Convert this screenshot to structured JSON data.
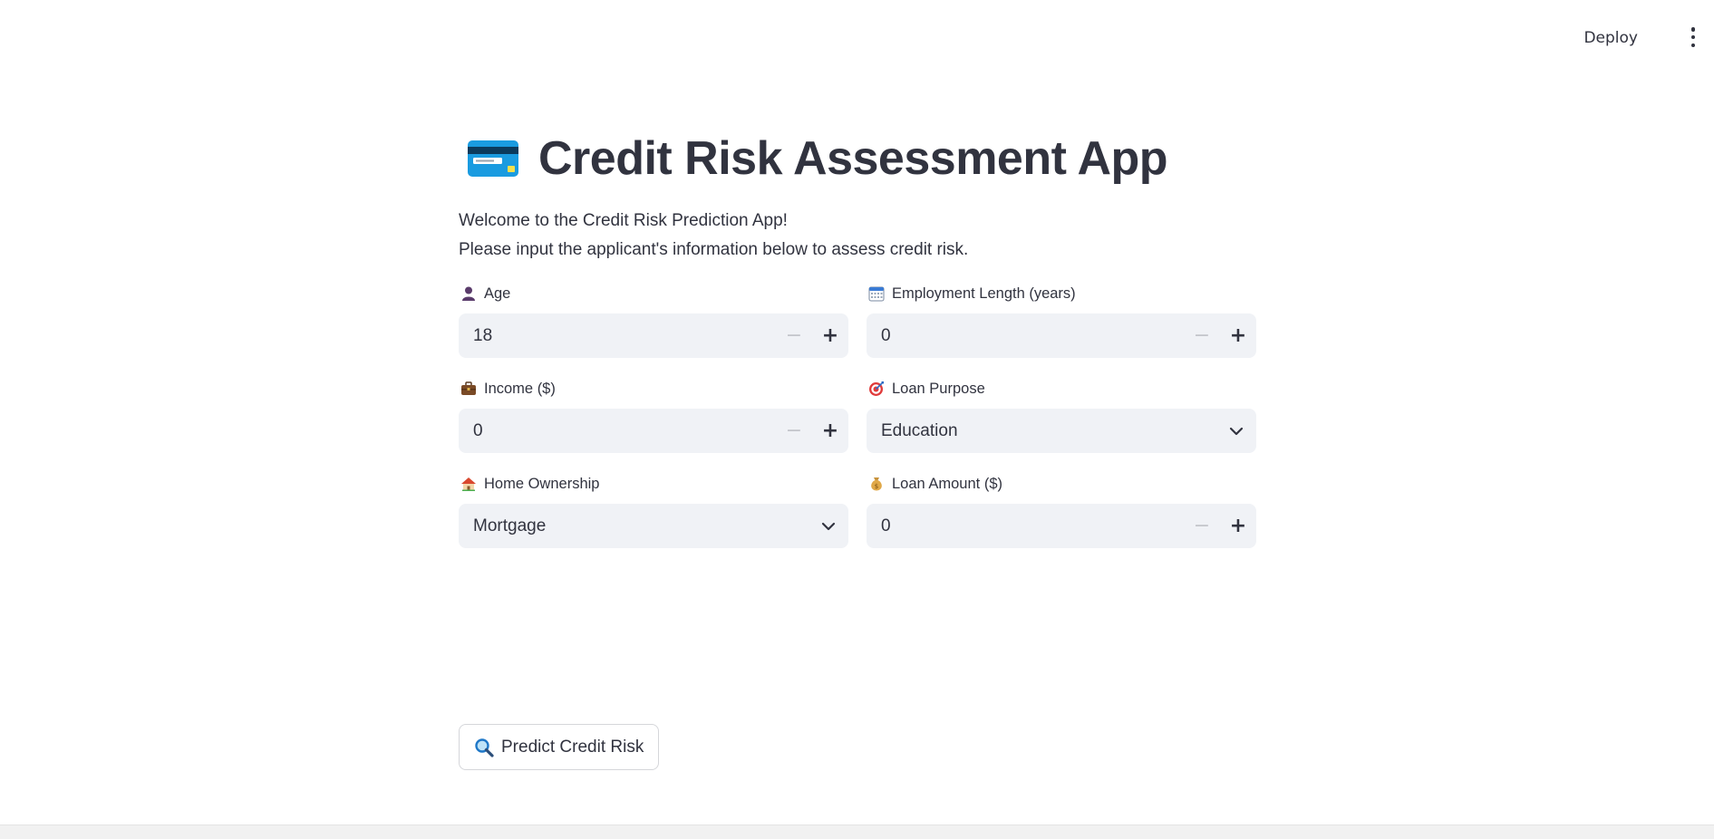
{
  "header": {
    "deploy_label": "Deploy",
    "menu_icon": "kebab-menu-icon"
  },
  "main": {
    "title": "Credit Risk Assessment App",
    "title_icon": "credit-card-icon",
    "intro_line1": "Welcome to the Credit Risk Prediction App!",
    "intro_line2": "Please input the applicant's information below to assess credit risk."
  },
  "fields": {
    "age": {
      "label": "Age",
      "icon": "person-icon",
      "value": "18"
    },
    "employment": {
      "label": "Employment Length (years)",
      "icon": "calendar-icon",
      "value": "0"
    },
    "income": {
      "label": "Income ($)",
      "icon": "briefcase-icon",
      "value": "0"
    },
    "loan_purpose": {
      "label": "Loan Purpose",
      "icon": "target-icon",
      "value": "Education"
    },
    "home": {
      "label": "Home Ownership",
      "icon": "house-icon",
      "value": "Mortgage"
    },
    "loan_amount": {
      "label": "Loan Amount ($)",
      "icon": "money-bag-icon",
      "value": "0"
    }
  },
  "actions": {
    "predict_label": "Predict Credit Risk",
    "predict_icon": "magnifier-icon"
  },
  "colors": {
    "text": "#31333f",
    "input_bg": "#f0f2f6",
    "border": "#d5d6da"
  }
}
